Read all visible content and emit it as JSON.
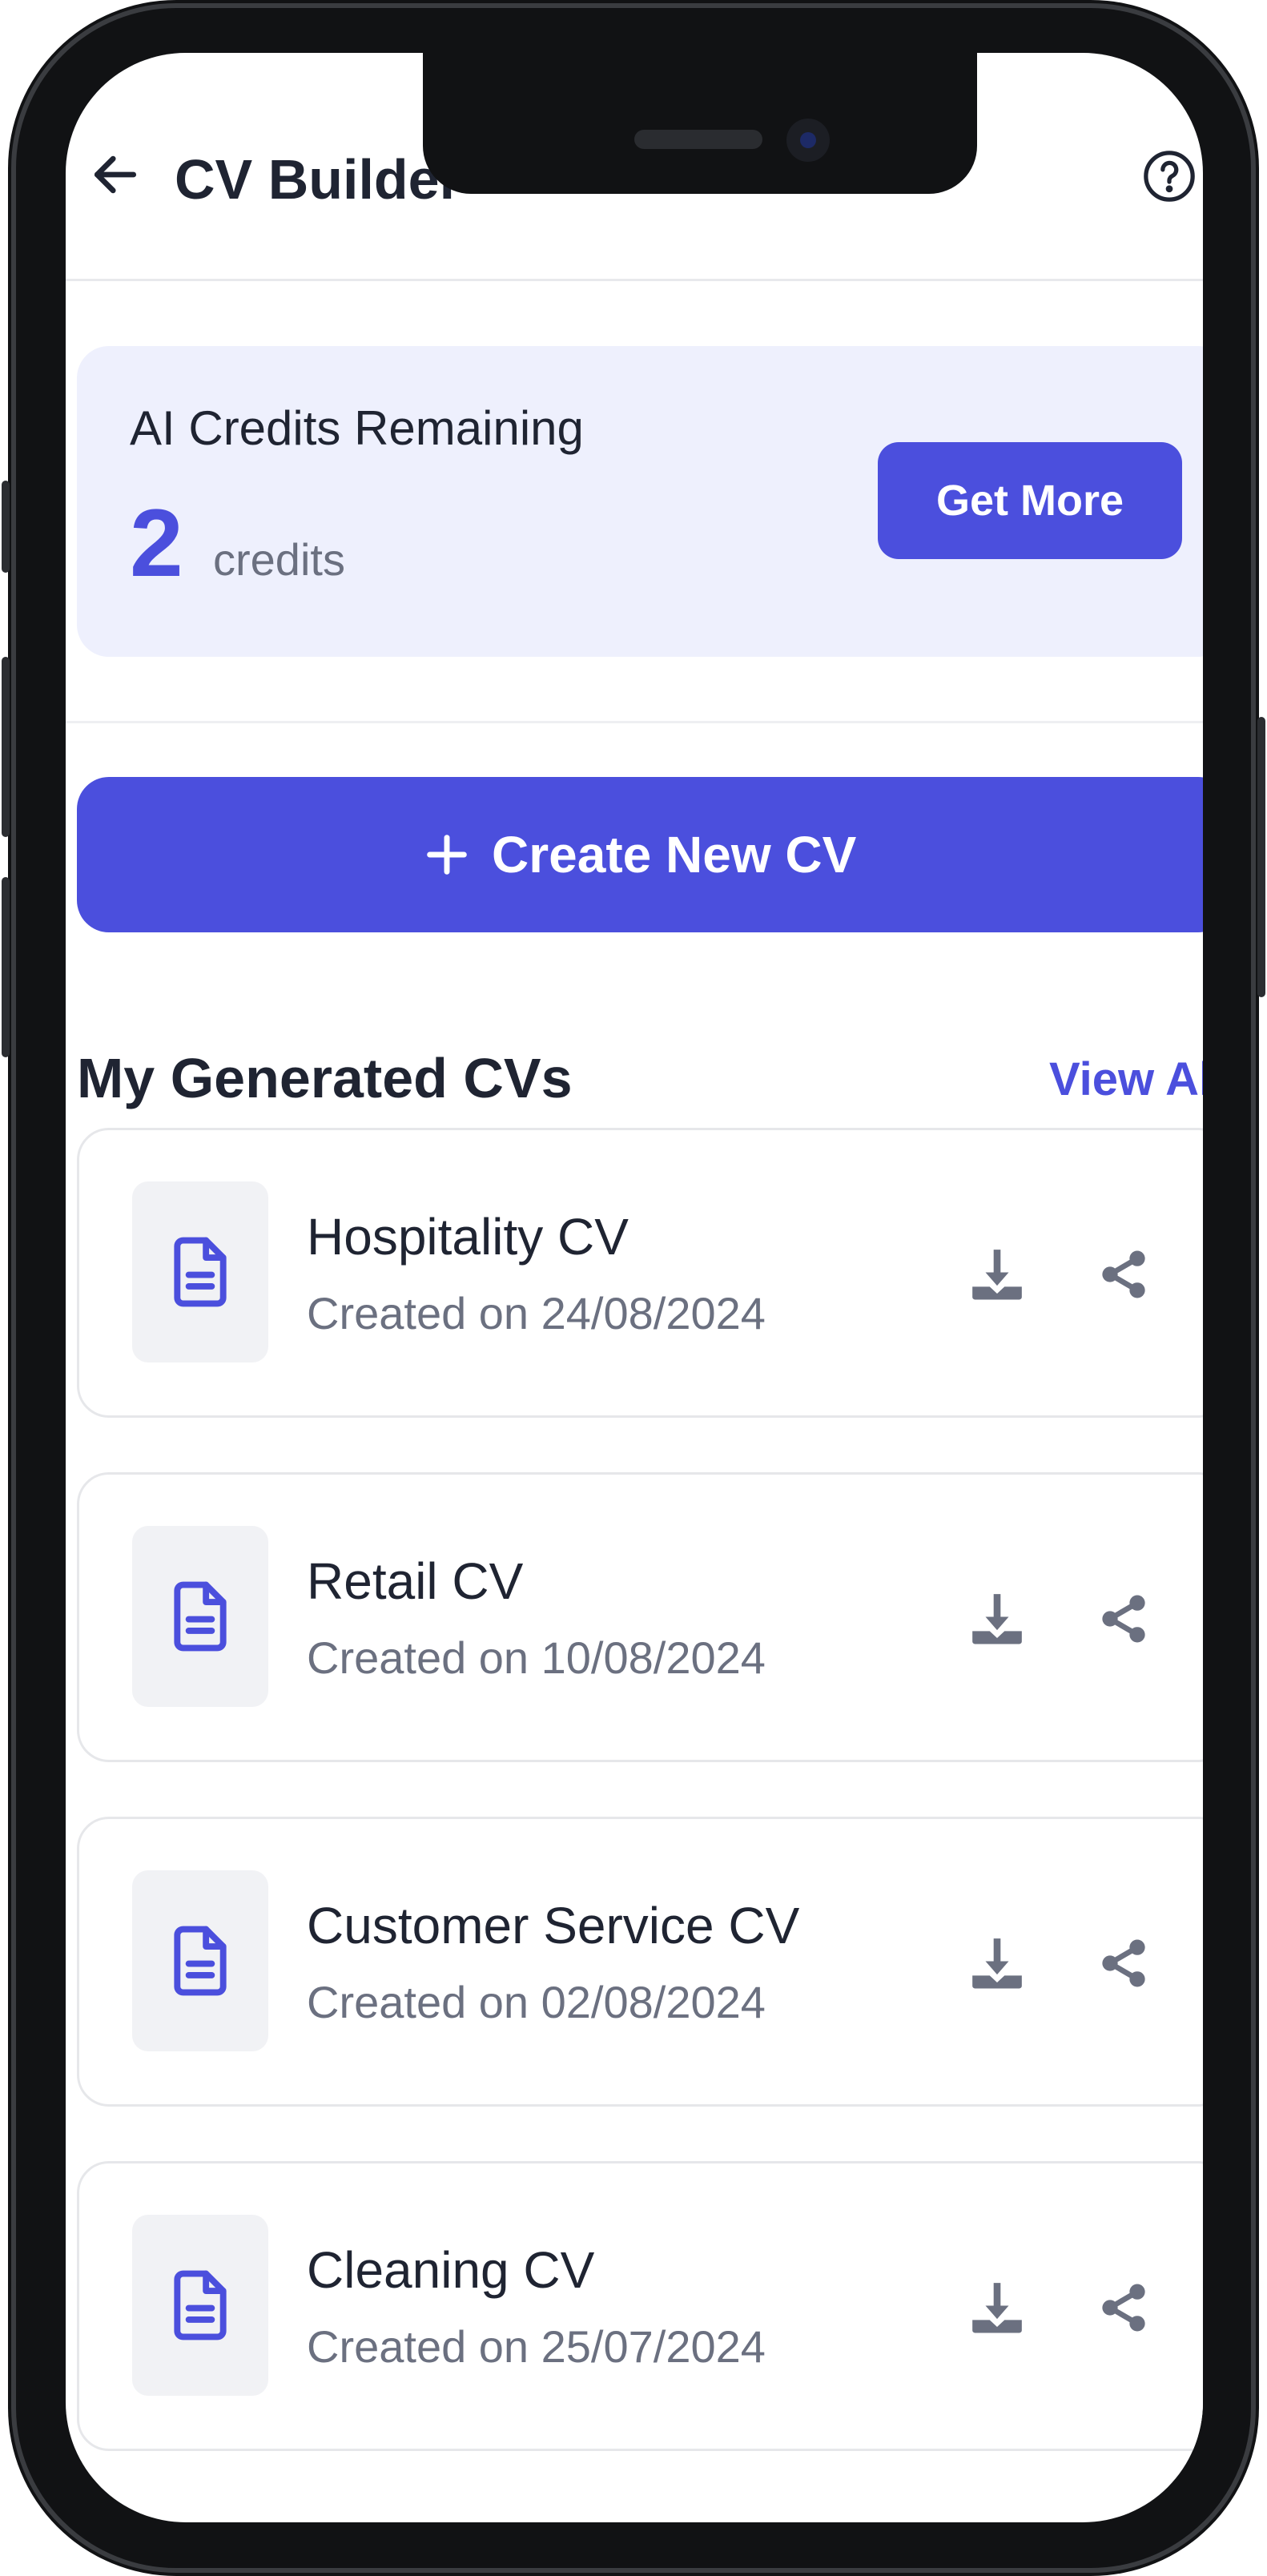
{
  "header": {
    "back_icon": "arrow-left-icon",
    "title": "CV Builder",
    "help_icon": "question-circle-icon"
  },
  "credits": {
    "label": "AI Credits Remaining",
    "value": "2",
    "unit": "credits",
    "button_label": "Get More"
  },
  "create": {
    "icon": "plus-icon",
    "label": "Create New CV"
  },
  "section": {
    "title": "My Generated CVs",
    "view_all_label": "View All"
  },
  "cvs": [
    {
      "title": "Hospitality CV",
      "date": "Created on 24/08/2024"
    },
    {
      "title": "Retail CV",
      "date": "Created on 10/08/2024"
    },
    {
      "title": "Customer Service CV",
      "date": "Created on 02/08/2024"
    },
    {
      "title": "Cleaning CV",
      "date": "Created on 25/07/2024"
    }
  ],
  "icons": {
    "document": "document-icon",
    "download": "download-icon",
    "share": "share-icon"
  },
  "colors": {
    "accent": "#4b4fdd",
    "card_tint": "#eef0fd",
    "text_primary": "#1f2432",
    "text_secondary": "#6b7080",
    "icon_gray": "#6b7080"
  }
}
